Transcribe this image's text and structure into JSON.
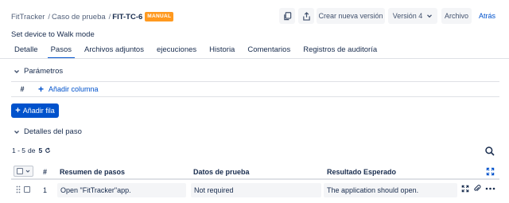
{
  "breadcrumb": {
    "project": "FitTracker",
    "section": "Caso de prueba",
    "key": "FIT-TC-6",
    "badge": "MANUAL"
  },
  "toolbar": {
    "new_version": "Crear nueva versión",
    "version": "Versión 4",
    "archive": "Archivo",
    "back": "Atrás"
  },
  "summary": "Set device to Walk mode",
  "tabs": [
    {
      "label": "Detalle"
    },
    {
      "label": "Pasos",
      "active": true
    },
    {
      "label": "Archivos adjuntos"
    },
    {
      "label": "ejecuciones"
    },
    {
      "label": "Historia"
    },
    {
      "label": "Comentarios"
    },
    {
      "label": "Registros de auditoría"
    }
  ],
  "parameters": {
    "title": "Parámetros",
    "hash": "#",
    "add_column": "Añadir columna"
  },
  "add_row": "Añadir fila",
  "step_details": {
    "title": "Detalles del paso",
    "pagination": {
      "range": "1 - 5",
      "of": "de",
      "total": "5"
    }
  },
  "table": {
    "headers": {
      "num": "#",
      "summary": "Resumen de pasos",
      "test_data": "Datos de prueba",
      "expected": "Resultado Esperado"
    },
    "rows": [
      {
        "num": "1",
        "summary": "Open \"FitTracker\"app.",
        "test_data": "Not required",
        "expected": "The application should open."
      }
    ]
  },
  "colors": {
    "primary": "#0052cc",
    "badge": "#ff991f",
    "text": "#172b4d",
    "cell_bg": "#f4f5f7"
  },
  "icons": [
    "copy-icon",
    "export-icon",
    "chevron-down-icon",
    "search-icon",
    "expand-icon",
    "drag-handle-icon",
    "attachment-icon",
    "more-icon",
    "refresh-icon"
  ]
}
